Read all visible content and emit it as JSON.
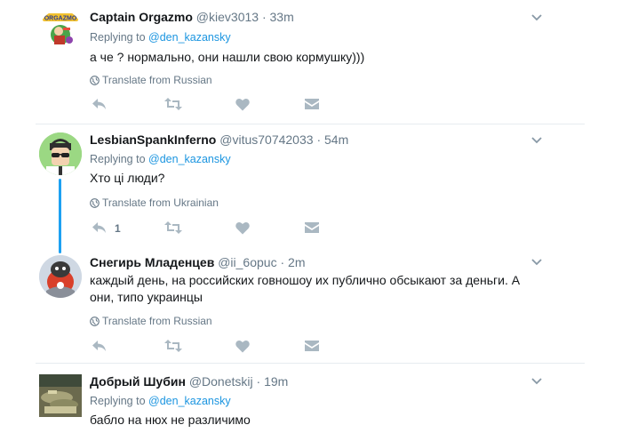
{
  "icons": {
    "reply": "reply-icon",
    "retweet": "retweet-icon",
    "like": "heart-icon",
    "dm": "envelope-icon",
    "caret": "chevron-down-icon",
    "globe": "globe-icon"
  },
  "colors": {
    "link": "#1b95e0",
    "muted": "#657786",
    "thread_line": "#1da1f2",
    "icon": "#aab8c2"
  },
  "tweets": [
    {
      "name": "Captain Orgazmo",
      "handle": "@kiev3013",
      "dot": "·",
      "time": "33m",
      "replying_prefix": "Replying to",
      "replying_handle": "@den_kazansky",
      "text": "а че ? нормально, они нашли свою кормушку)))",
      "translate": "Translate from Russian",
      "reply_count": ""
    },
    {
      "name": "LesbianSpankInferno",
      "handle": "@vitus70742033",
      "dot": "·",
      "time": "54m",
      "replying_prefix": "Replying to",
      "replying_handle": "@den_kazansky",
      "text": "Хто ці люди?",
      "translate": "Translate from Ukrainian",
      "reply_count": "1"
    },
    {
      "name": "Снегирь Младенцев",
      "handle": "@ii_6opuc",
      "dot": "·",
      "time": "2m",
      "replying_prefix": "",
      "replying_handle": "",
      "text": "каждый день, на российских говношоу их публично обсыкают за деньги. А они, типо украинцы",
      "translate": "Translate from Russian",
      "reply_count": ""
    },
    {
      "name": "Добрый Шубин",
      "handle": "@Donetskij",
      "dot": "·",
      "time": "19m",
      "replying_prefix": "Replying to",
      "replying_handle": "@den_kazansky",
      "text": "бабло на нюх не различимо",
      "translate": "",
      "reply_count": ""
    }
  ]
}
